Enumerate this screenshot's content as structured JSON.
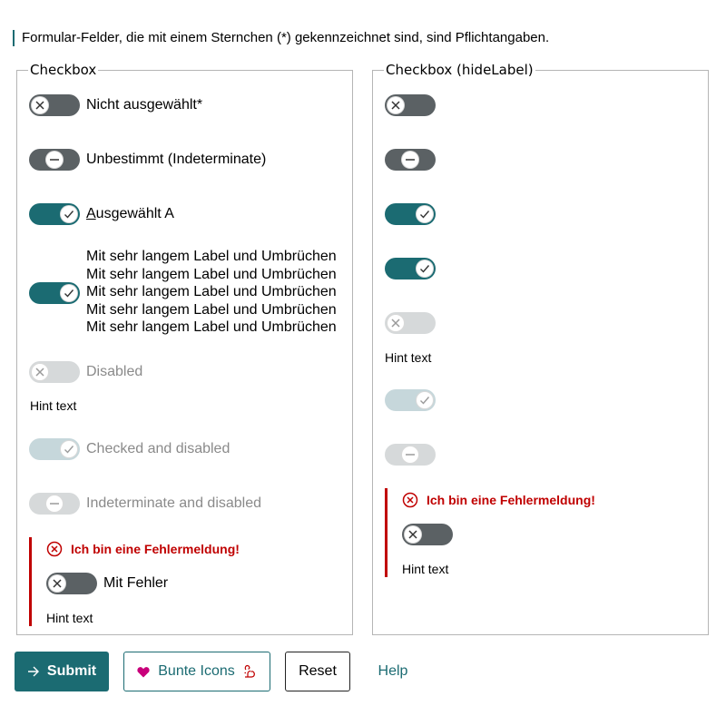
{
  "required_note": "Formular-Felder, die mit einem Sternchen (*) gekennzeichnet sind, sind Pflichtangaben.",
  "left_panel": {
    "legend": "Checkbox",
    "items": [
      {
        "label": "Nicht ausgewählt",
        "required_mark": "*"
      },
      {
        "label": "Unbestimmt (Indeterminate)"
      },
      {
        "label_first": "A",
        "label_rest": "usgewählt A"
      },
      {
        "lines": [
          "Mit sehr langem Label und Umbrüchen",
          "Mit sehr langem Label und Umbrüchen",
          "Mit sehr langem Label und Umbrüchen",
          "Mit sehr langem Label und Umbrüchen",
          "Mit sehr langem Label und Umbrüchen"
        ]
      },
      {
        "label": "Disabled"
      },
      {
        "label": "Checked and disabled"
      },
      {
        "label": "Indeterminate and disabled"
      }
    ],
    "hint": "Hint text",
    "error": {
      "message": "Ich bin eine Fehlermeldung!",
      "label": "Mit Fehler",
      "hint": "Hint text"
    }
  },
  "right_panel": {
    "legend": "Checkbox (hideLabel)",
    "hint": "Hint text",
    "error": {
      "message": "Ich bin eine Fehlermeldung!",
      "hint": "Hint text"
    }
  },
  "buttons": {
    "submit": "Submit",
    "icons": "Bunte Icons",
    "reset": "Reset",
    "help": "Help"
  },
  "icons": {
    "submit": "arrow-right-icon",
    "heart": "heart-icon",
    "squirrel": "squirrel-icon",
    "error": "error-circle-icon"
  },
  "colors": {
    "accent": "#1b6b72",
    "error": "#c00000",
    "switch_off": "#5b6164",
    "heart": "#c8007a"
  }
}
